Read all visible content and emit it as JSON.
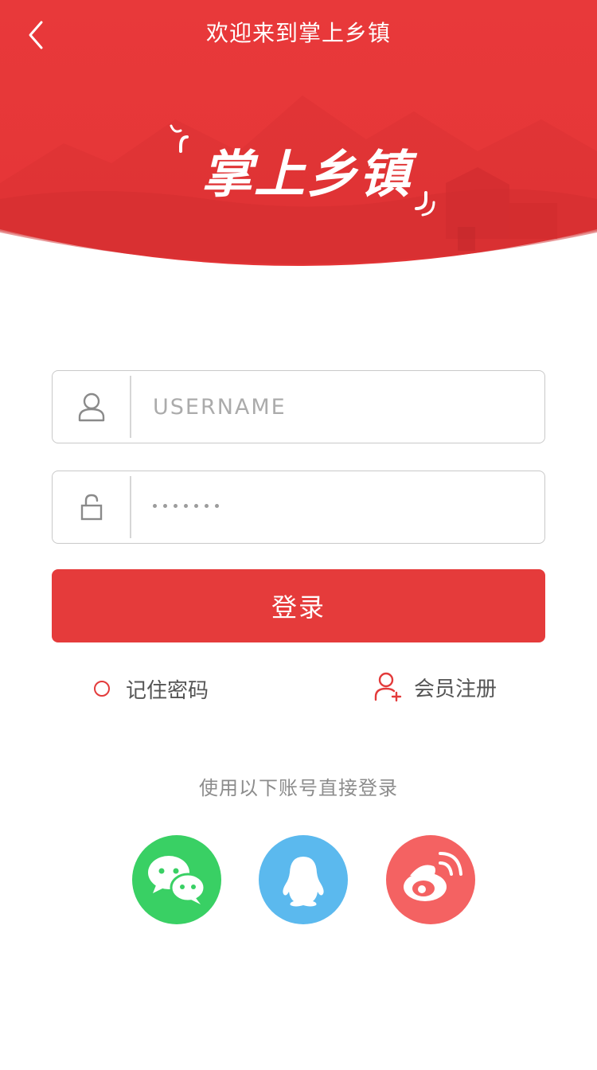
{
  "header": {
    "title": "欢迎来到掌上乡镇",
    "logo_text": "掌上乡镇",
    "background_color": "#e53b3b"
  },
  "form": {
    "username_placeholder": "USERNAME",
    "password_masked": "•••••••",
    "login_label": "登录",
    "remember_label": "记住密码",
    "register_label": "会员注册"
  },
  "social": {
    "heading": "使用以下账号直接登录",
    "providers": [
      {
        "name": "wechat",
        "color": "#39d064"
      },
      {
        "name": "qq",
        "color": "#5bb9ee"
      },
      {
        "name": "weibo",
        "color": "#f46262"
      }
    ]
  },
  "colors": {
    "accent": "#e53b3b",
    "field_border": "#c9c9c9",
    "muted_text": "#8c8c8c"
  }
}
